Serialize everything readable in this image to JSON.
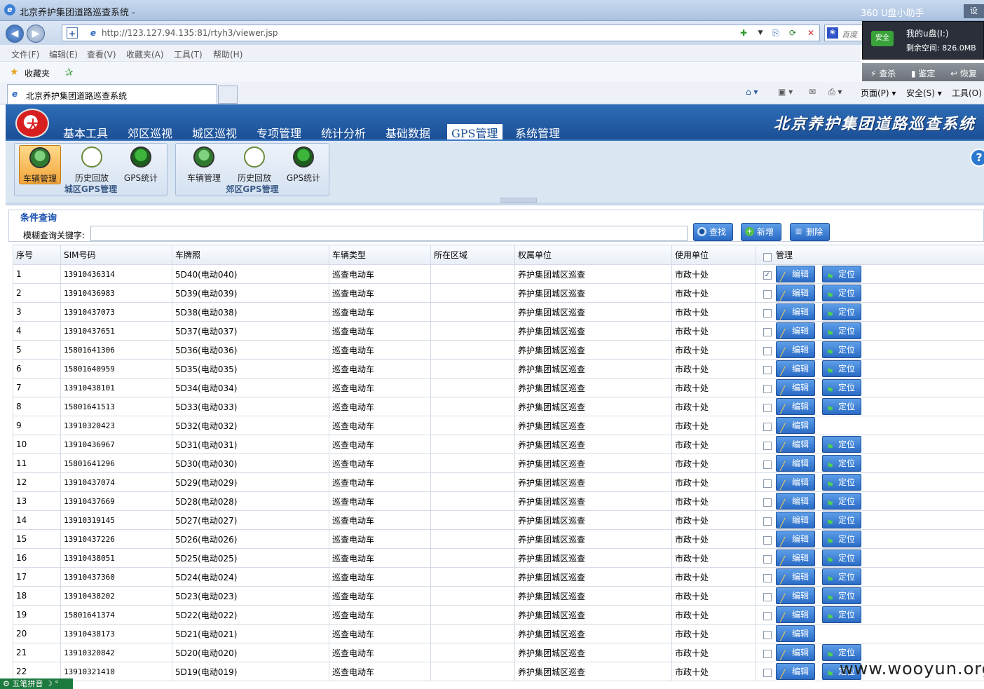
{
  "browser": {
    "title": "北京养护集团道路巡查系统 -",
    "helper": "360 U盘小助手",
    "settings": "设",
    "url": "http://123.127.94.135:81/rtyh3/viewer.jsp",
    "search_placeholder": "百度",
    "menu": [
      "文件(F)",
      "编辑(E)",
      "查看(V)",
      "收藏夹(A)",
      "工具(T)",
      "帮助(H)"
    ],
    "favorites_label": "收藏夹",
    "tab_title": "北京养护集团道路巡查系统",
    "commands": [
      "页面(P) ▾",
      "安全(S) ▾",
      "工具(O)"
    ]
  },
  "udisk": {
    "badge": "安全",
    "name": "我的u盘(I:)",
    "space": "剩余空间: 826.0MB",
    "actions": [
      "查杀",
      "鉴定",
      "恢复"
    ]
  },
  "app": {
    "brand": "北京养护集团道路巡查系统",
    "nav": [
      "基本工具",
      "郊区巡视",
      "城区巡视",
      "专项管理",
      "统计分析",
      "基础数据",
      "GPS管理",
      "系统管理"
    ],
    "active_nav": "GPS管理",
    "groups": [
      {
        "title": "城区GPS管理",
        "tools": [
          {
            "label": "车辆管理",
            "icon": "car-icon"
          },
          {
            "label": "历史回放",
            "icon": "clock-icon"
          },
          {
            "label": "GPS统计",
            "icon": "stats-icon"
          }
        ]
      },
      {
        "title": "郊区GPS管理",
        "tools": [
          {
            "label": "车辆管理",
            "icon": "car-icon"
          },
          {
            "label": "历史回放",
            "icon": "clock-icon"
          },
          {
            "label": "GPS统计",
            "icon": "stats-icon"
          }
        ]
      }
    ]
  },
  "query": {
    "legend": "条件查询",
    "label": "模糊查询关键字:",
    "keyword": "",
    "buttons": {
      "search": "查找",
      "add": "新增",
      "delete": "删除"
    }
  },
  "table": {
    "columns": [
      "序号",
      "SIM号码",
      "车牌照",
      "车辆类型",
      "所在区域",
      "权属单位",
      "使用单位",
      "管理"
    ],
    "edit_label": "编辑",
    "locate_label": "定位",
    "rows": [
      {
        "no": "1",
        "sim": "13910436314",
        "plate": "5D40(电动040)",
        "type": "巡查电动车",
        "area": "",
        "owner": "养护集团城区巡查",
        "user": "市政十处",
        "checked": true,
        "locate": true
      },
      {
        "no": "2",
        "sim": "13910436983",
        "plate": "5D39(电动039)",
        "type": "巡查电动车",
        "area": "",
        "owner": "养护集团城区巡查",
        "user": "市政十处",
        "checked": false,
        "locate": true
      },
      {
        "no": "3",
        "sim": "13910437073",
        "plate": "5D38(电动038)",
        "type": "巡查电动车",
        "area": "",
        "owner": "养护集团城区巡查",
        "user": "市政十处",
        "checked": false,
        "locate": true
      },
      {
        "no": "4",
        "sim": "13910437651",
        "plate": "5D37(电动037)",
        "type": "巡查电动车",
        "area": "",
        "owner": "养护集团城区巡查",
        "user": "市政十处",
        "checked": false,
        "locate": true
      },
      {
        "no": "5",
        "sim": "15801641306",
        "plate": "5D36(电动036)",
        "type": "巡查电动车",
        "area": "",
        "owner": "养护集团城区巡查",
        "user": "市政十处",
        "checked": false,
        "locate": true
      },
      {
        "no": "6",
        "sim": "15801640959",
        "plate": "5D35(电动035)",
        "type": "巡查电动车",
        "area": "",
        "owner": "养护集团城区巡查",
        "user": "市政十处",
        "checked": false,
        "locate": true
      },
      {
        "no": "7",
        "sim": "13910438101",
        "plate": "5D34(电动034)",
        "type": "巡查电动车",
        "area": "",
        "owner": "养护集团城区巡查",
        "user": "市政十处",
        "checked": false,
        "locate": true
      },
      {
        "no": "8",
        "sim": "15801641513",
        "plate": "5D33(电动033)",
        "type": "巡查电动车",
        "area": "",
        "owner": "养护集团城区巡查",
        "user": "市政十处",
        "checked": false,
        "locate": true
      },
      {
        "no": "9",
        "sim": "13910320423",
        "plate": "5D32(电动032)",
        "type": "巡查电动车",
        "area": "",
        "owner": "养护集团城区巡查",
        "user": "市政十处",
        "checked": false,
        "locate": false
      },
      {
        "no": "10",
        "sim": "13910436967",
        "plate": "5D31(电动031)",
        "type": "巡查电动车",
        "area": "",
        "owner": "养护集团城区巡查",
        "user": "市政十处",
        "checked": false,
        "locate": true
      },
      {
        "no": "11",
        "sim": "15801641296",
        "plate": "5D30(电动030)",
        "type": "巡查电动车",
        "area": "",
        "owner": "养护集团城区巡查",
        "user": "市政十处",
        "checked": false,
        "locate": true
      },
      {
        "no": "12",
        "sim": "13910437074",
        "plate": "5D29(电动029)",
        "type": "巡查电动车",
        "area": "",
        "owner": "养护集团城区巡查",
        "user": "市政十处",
        "checked": false,
        "locate": true
      },
      {
        "no": "13",
        "sim": "13910437669",
        "plate": "5D28(电动028)",
        "type": "巡查电动车",
        "area": "",
        "owner": "养护集团城区巡查",
        "user": "市政十处",
        "checked": false,
        "locate": true
      },
      {
        "no": "14",
        "sim": "13910319145",
        "plate": "5D27(电动027)",
        "type": "巡查电动车",
        "area": "",
        "owner": "养护集团城区巡查",
        "user": "市政十处",
        "checked": false,
        "locate": true
      },
      {
        "no": "15",
        "sim": "13910437226",
        "plate": "5D26(电动026)",
        "type": "巡查电动车",
        "area": "",
        "owner": "养护集团城区巡查",
        "user": "市政十处",
        "checked": false,
        "locate": true
      },
      {
        "no": "16",
        "sim": "13910438051",
        "plate": "5D25(电动025)",
        "type": "巡查电动车",
        "area": "",
        "owner": "养护集团城区巡查",
        "user": "市政十处",
        "checked": false,
        "locate": true
      },
      {
        "no": "17",
        "sim": "13910437360",
        "plate": "5D24(电动024)",
        "type": "巡查电动车",
        "area": "",
        "owner": "养护集团城区巡查",
        "user": "市政十处",
        "checked": false,
        "locate": true
      },
      {
        "no": "18",
        "sim": "13910438202",
        "plate": "5D23(电动023)",
        "type": "巡查电动车",
        "area": "",
        "owner": "养护集团城区巡查",
        "user": "市政十处",
        "checked": false,
        "locate": true
      },
      {
        "no": "19",
        "sim": "15801641374",
        "plate": "5D22(电动022)",
        "type": "巡查电动车",
        "area": "",
        "owner": "养护集团城区巡查",
        "user": "市政十处",
        "checked": false,
        "locate": true
      },
      {
        "no": "20",
        "sim": "13910438173",
        "plate": "5D21(电动021)",
        "type": "巡查电动车",
        "area": "",
        "owner": "养护集团城区巡查",
        "user": "市政十处",
        "checked": false,
        "locate": false
      },
      {
        "no": "21",
        "sim": "13910320842",
        "plate": "5D20(电动020)",
        "type": "巡查电动车",
        "area": "",
        "owner": "养护集团城区巡查",
        "user": "市政十处",
        "checked": false,
        "locate": true
      },
      {
        "no": "22",
        "sim": "13910321410",
        "plate": "5D19(电动019)",
        "type": "巡查电动车",
        "area": "",
        "owner": "养护集团城区巡查",
        "user": "市政十处",
        "checked": false,
        "locate": true
      }
    ]
  },
  "ime": "五笔拼音",
  "watermark": "www.wooyun.org"
}
